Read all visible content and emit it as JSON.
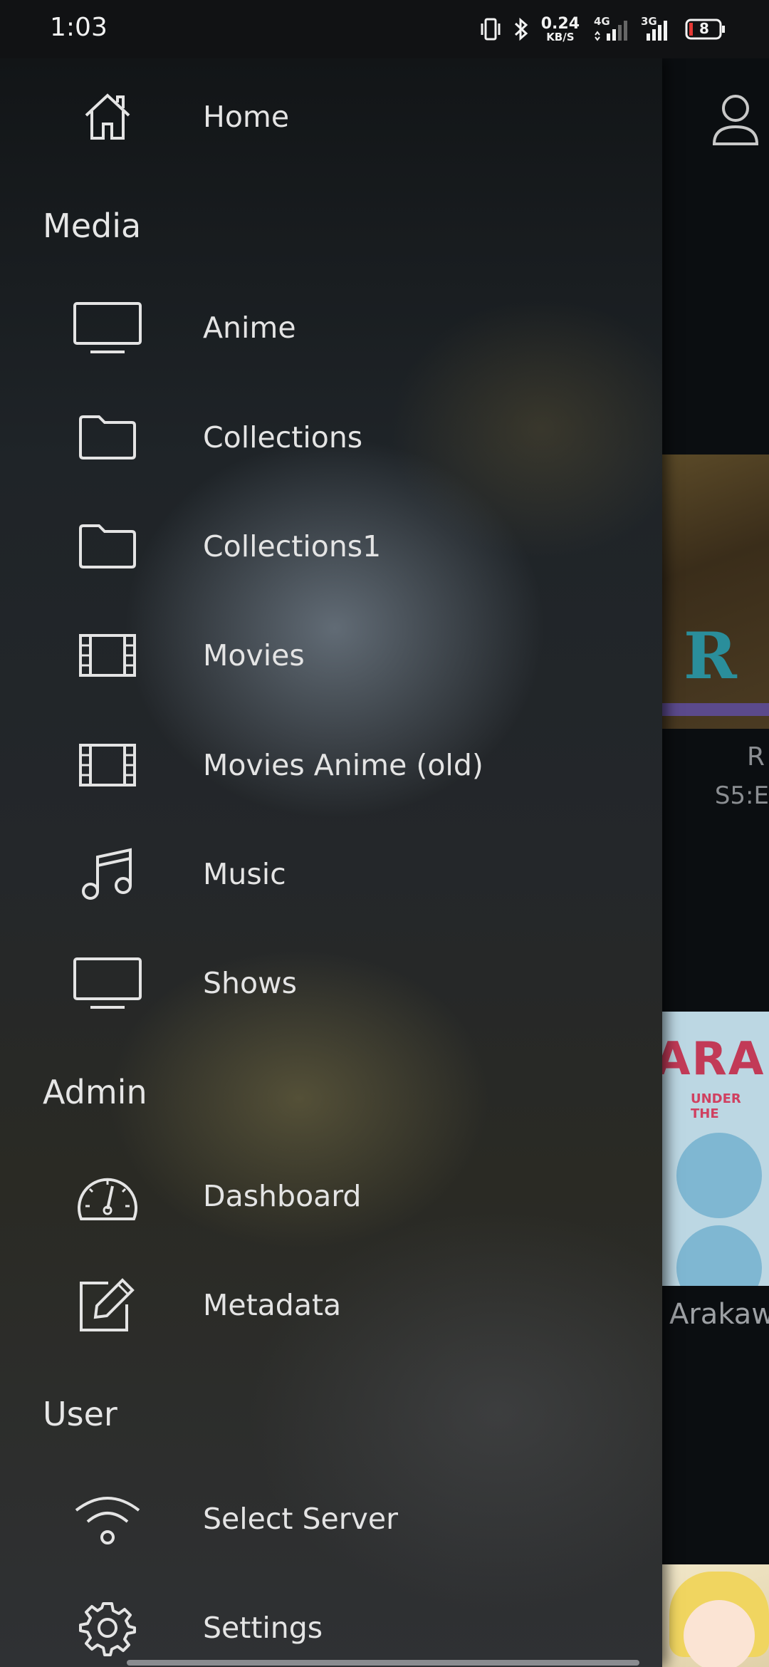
{
  "status_bar": {
    "time": "1:03",
    "net_speed_value": "0.24",
    "net_speed_unit": "KB/S",
    "net_type_1": "4G",
    "net_type_2": "3G",
    "battery": "8"
  },
  "drawer": {
    "home_label": "Home",
    "section_media": "Media",
    "media_items": [
      "Anime",
      "Collections",
      "Collections1",
      "Movies",
      "Movies Anime (old)",
      "Music",
      "Shows"
    ],
    "section_admin": "Admin",
    "admin_items": [
      "Dashboard",
      "Metadata"
    ],
    "section_user": "User",
    "user_items": [
      "Select Server",
      "Settings"
    ]
  },
  "background": {
    "card1_title": "R",
    "card1_subtitle": "S5:E",
    "card2_logo": "ARAK",
    "card2_under": "UNDER THE",
    "card2_title": "Arakaw"
  },
  "colors": {
    "card1_logo": "#2a8e9b",
    "card2_logo": "#c23a57"
  }
}
